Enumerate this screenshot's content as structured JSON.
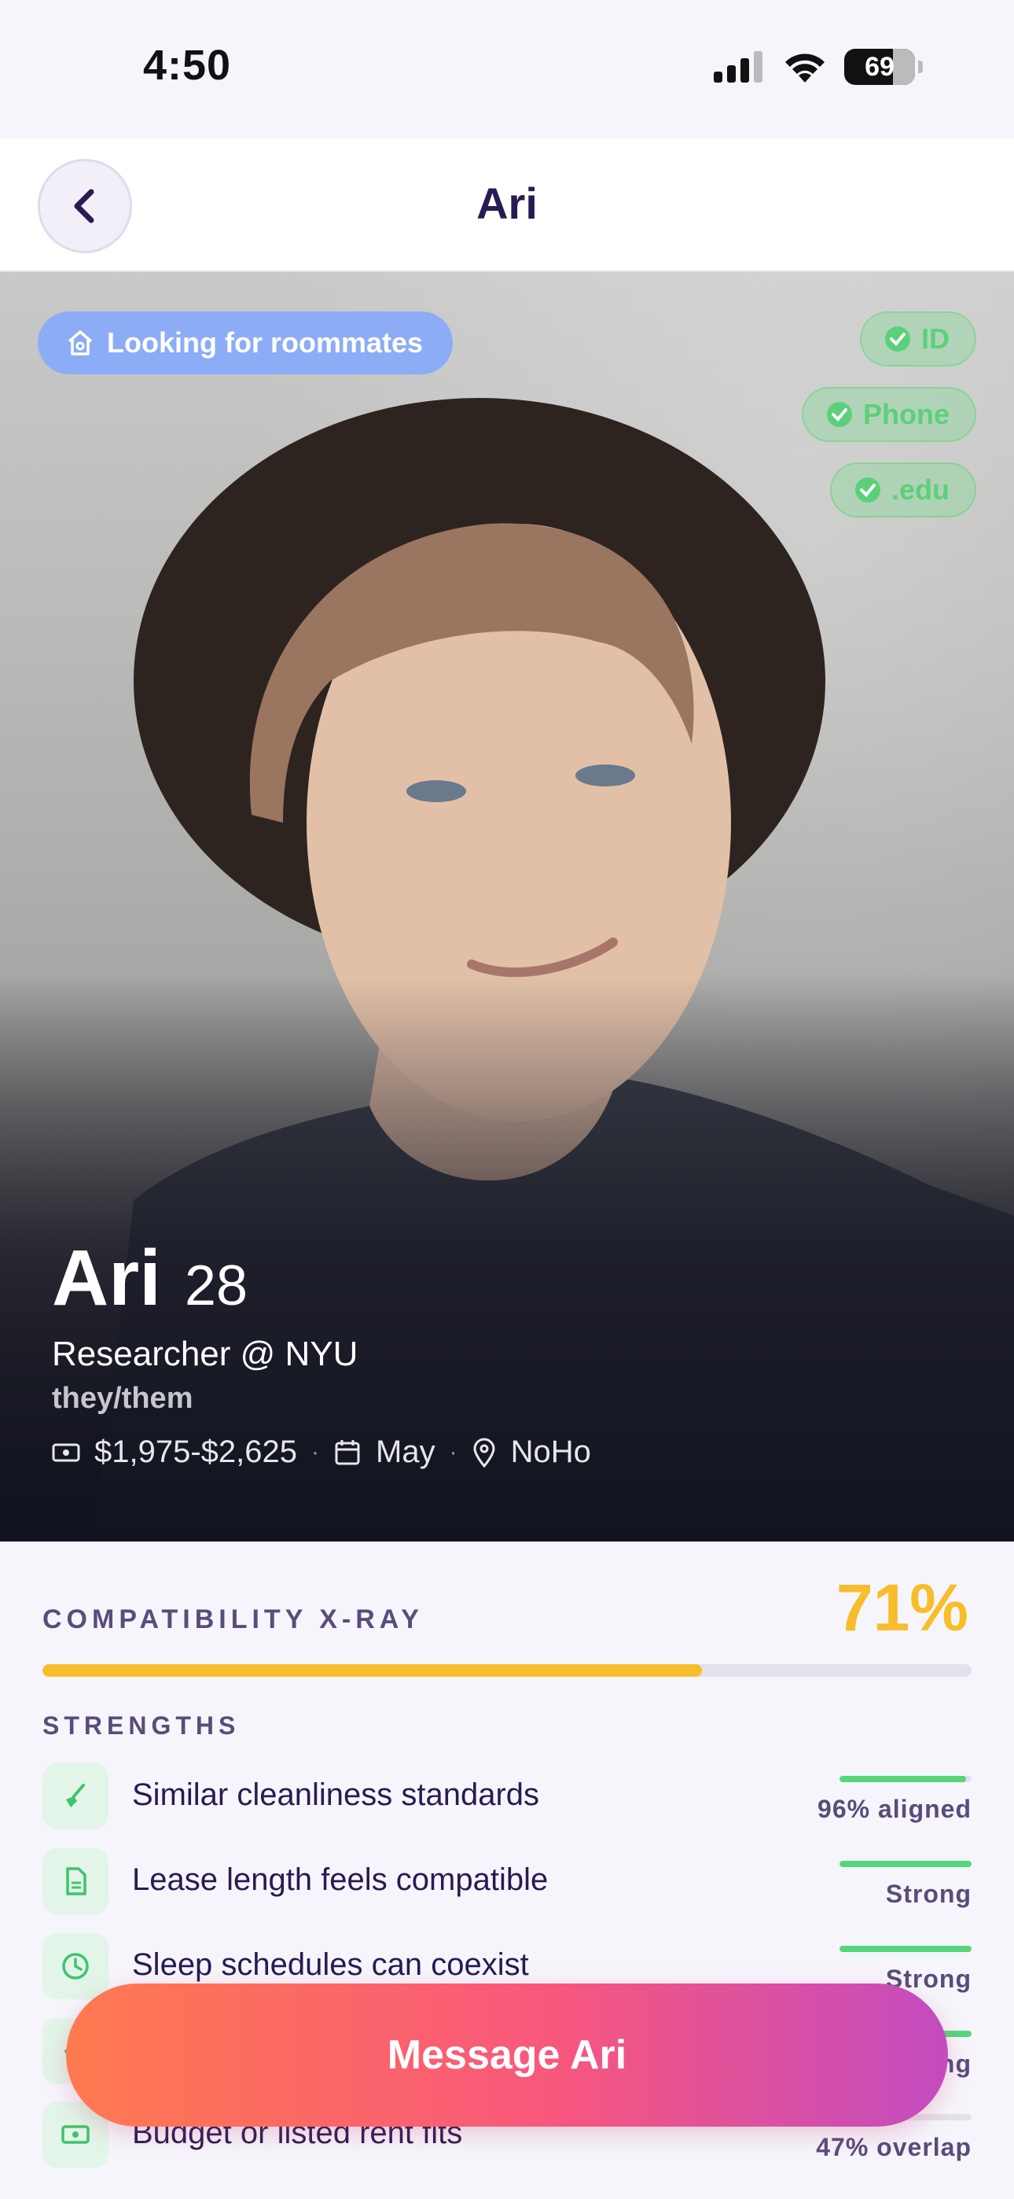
{
  "status": {
    "time": "4:50",
    "battery": "69"
  },
  "nav": {
    "title": "Ari"
  },
  "hero": {
    "looking_badge": "Looking for roommates",
    "verifications": [
      "ID",
      "Phone",
      ".edu"
    ],
    "name": "Ari",
    "age": "28",
    "job": "Researcher @ NYU",
    "pronouns": "they/them",
    "budget": "$1,975-$2,625",
    "move_in": "May",
    "neighborhood": "NoHo",
    "separator": "·"
  },
  "compatibility": {
    "title": "COMPATIBILITY X-RAY",
    "percent_label": "71%",
    "percent": 71,
    "strengths_title": "STRENGTHS",
    "rows": [
      {
        "label": "Similar cleanliness standards",
        "value": "96% aligned",
        "level": 0.96,
        "icon": "broom-icon"
      },
      {
        "label": "Lease length feels compatible",
        "value": "Strong",
        "level": 1.0,
        "icon": "document-icon"
      },
      {
        "label": "Sleep schedules can coexist",
        "value": "Strong",
        "level": 1.0,
        "icon": "clock-icon"
      },
      {
        "label": "",
        "value": "Strong",
        "level": 1.0,
        "icon": "check-icon"
      },
      {
        "label": "Budget or listed rent fits",
        "value": "47% overlap",
        "level": 0.47,
        "icon": "cash-icon"
      }
    ]
  },
  "cta": {
    "label": "Message Ari"
  },
  "colors": {
    "accent": "#f7bd2a",
    "verified": "#5bd07a",
    "badge_blue": "#8cacf6",
    "title": "#2a1a52"
  }
}
